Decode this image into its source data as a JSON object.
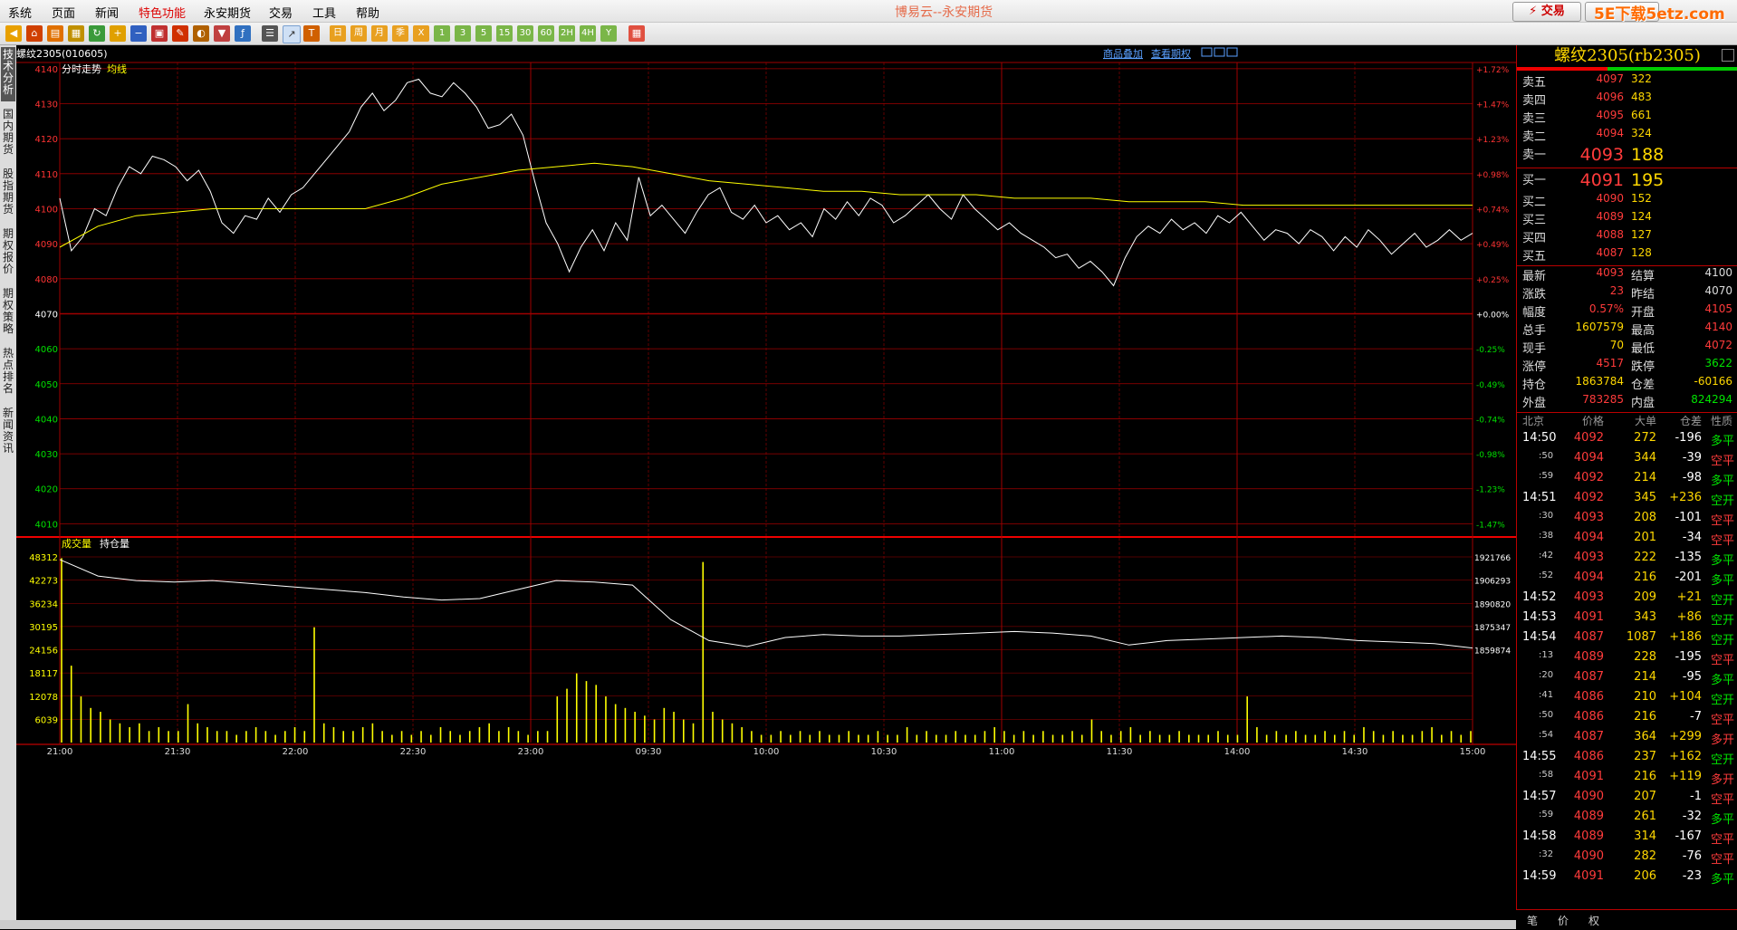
{
  "app": {
    "title": "博易云--永安期货",
    "watermark": "5E下载5etz.com",
    "trade_label": "⚡ 交易"
  },
  "menu": [
    "系统",
    "页面",
    "新闻",
    "特色功能",
    "永安期货",
    "交易",
    "工具",
    "帮助"
  ],
  "menu_active": "特色功能",
  "toolbar": {
    "icons": [
      "back-arrow-icon",
      "home-icon",
      "book-icon",
      "chart-icon",
      "refresh-icon",
      "zoom-in-icon",
      "zoom-out-icon",
      "layers-icon",
      "pen-icon",
      "palette-icon",
      "filter-icon",
      "indicator-icon",
      "table-icon",
      "trend-icon",
      "tick-icon"
    ],
    "periods": [
      "日",
      "周",
      "月",
      "季",
      "X",
      "1",
      "3",
      "5",
      "15",
      "30",
      "60",
      "2H",
      "4H",
      "Y"
    ],
    "calc_icon": "calculator-icon"
  },
  "left_tabs": [
    {
      "label": "技术分析",
      "selected": true
    },
    {
      "label": "国内期货",
      "selected": false
    },
    {
      "label": "股指期货",
      "selected": false
    },
    {
      "label": "期权报价",
      "selected": false
    },
    {
      "label": "期权策略",
      "selected": false
    },
    {
      "label": "热点排名",
      "selected": false
    },
    {
      "label": "新闻资讯",
      "selected": false
    }
  ],
  "chart": {
    "header": "螺纹2305(010605)",
    "links": [
      "商品叠加",
      "查看期权"
    ],
    "price_labels": {
      "a": "分时走势",
      "b": "均线"
    },
    "vol_labels": {
      "a": "成交量",
      "b": "持仓量"
    },
    "colors": {
      "grid": "#a00000",
      "price": "#ffffff",
      "avg": "#ffff00",
      "up": "#ff3333",
      "down": "#00e000",
      "neutral": "#ffffff",
      "axis_text_vol": "#ffff00"
    }
  },
  "chart_data": {
    "type": "line",
    "title": "分时走势",
    "reference_price": 4070,
    "price_axis": {
      "ticks": [
        4140,
        4130,
        4120,
        4110,
        4100,
        4090,
        4080,
        4070,
        4060,
        4050,
        4040,
        4030,
        4020,
        4010
      ],
      "range": [
        4007,
        4141
      ]
    },
    "pct_axis": {
      "ticks": [
        "+1.72%",
        "+1.47%",
        "+1.23%",
        "+0.98%",
        "+0.74%",
        "+0.49%",
        "+0.25%",
        "+0.00%",
        "-0.25%",
        "-0.49%",
        "-0.74%",
        "-0.98%",
        "-1.23%",
        "-1.47%"
      ]
    },
    "time_ticks": [
      "21:00",
      "21:30",
      "22:00",
      "22:30",
      "23:00",
      "09:30",
      "10:00",
      "10:30",
      "11:00",
      "11:30",
      "14:00",
      "14:30",
      "15:00"
    ],
    "series": [
      {
        "name": "分时走势",
        "x_range": [
          0,
          12
        ],
        "values": [
          4103,
          4088,
          4092,
          4100,
          4098,
          4106,
          4112,
          4110,
          4115,
          4114,
          4112,
          4108,
          4111,
          4105,
          4096,
          4093,
          4098,
          4097,
          4103,
          4099,
          4104,
          4106,
          4110,
          4114,
          4118,
          4122,
          4129,
          4133,
          4128,
          4131,
          4136,
          4137,
          4133,
          4132,
          4136,
          4133,
          4129,
          4123,
          4124,
          4127,
          4121,
          4108,
          4096,
          4090,
          4082,
          4089,
          4094,
          4088,
          4096,
          4091,
          4109,
          4098,
          4101,
          4097,
          4093,
          4099,
          4104,
          4106,
          4099,
          4097,
          4101,
          4096,
          4098,
          4094,
          4096,
          4092,
          4100,
          4097,
          4102,
          4098,
          4103,
          4101,
          4096,
          4098,
          4101,
          4104,
          4100,
          4097,
          4104,
          4100,
          4097,
          4094,
          4096,
          4093,
          4091,
          4089,
          4086,
          4087,
          4083,
          4085,
          4082,
          4078,
          4086,
          4092,
          4095,
          4093,
          4097,
          4094,
          4096,
          4093,
          4098,
          4096,
          4099,
          4095,
          4091,
          4094,
          4093,
          4090,
          4094,
          4092,
          4088,
          4092,
          4089,
          4094,
          4091,
          4087,
          4090,
          4093,
          4089,
          4091,
          4094,
          4091,
          4093
        ]
      },
      {
        "name": "均线",
        "x_range": [
          0,
          12
        ],
        "values": [
          4089,
          4095,
          4098,
          4099,
          4100,
          4100,
          4100,
          4100,
          4100,
          4103,
          4107,
          4109,
          4111,
          4112,
          4113,
          4112,
          4110,
          4108,
          4107,
          4106,
          4105,
          4105,
          4104,
          4104,
          4104,
          4103,
          4103,
          4103,
          4102,
          4102,
          4102,
          4101,
          4101,
          4101,
          4101,
          4101,
          4101,
          4101
        ]
      }
    ],
    "volume_axis": {
      "ticks": [
        48312,
        42273,
        36234,
        30195,
        24156,
        18117,
        12078,
        6039
      ]
    },
    "oi_axis": {
      "ticks": [
        1921766,
        1906293,
        1890820,
        1875347,
        1859874
      ]
    },
    "volume_spikes": [
      {
        "x": 1.8,
        "value": 30000
      },
      {
        "x": 3.9,
        "value": 47000
      },
      {
        "x": 3.5,
        "value": 18000
      },
      {
        "x": 8.4,
        "value": 12000
      }
    ],
    "volume_sample": [
      48000,
      20000,
      12000,
      9000,
      8000,
      6000,
      5000,
      4000,
      5000,
      3000,
      4000,
      3000,
      3000,
      10000,
      5000,
      4000,
      3000,
      3000,
      2000,
      3000,
      4000,
      3000,
      2000,
      3000,
      4000,
      3000,
      30000,
      5000,
      4000,
      3000,
      3000,
      4000,
      5000,
      3000,
      2000,
      3000,
      2000,
      3000,
      2000,
      4000,
      3000,
      2000,
      3000,
      4000,
      5000,
      3000,
      4000,
      3000,
      2000,
      3000,
      3000,
      12000,
      14000,
      18000,
      16000,
      15000,
      12000,
      10000,
      9000,
      8000,
      7000,
      6000,
      9000,
      8000,
      6000,
      5000,
      47000,
      8000,
      6000,
      5000,
      4000,
      3000,
      2000,
      2000,
      3000,
      2000,
      3000,
      2000,
      3000,
      2000,
      2000,
      3000,
      2000,
      2000,
      3000,
      2000,
      2000,
      4000,
      2000,
      3000,
      2000,
      2000,
      3000,
      2000,
      2000,
      3000,
      4000,
      3000,
      2000,
      3000,
      2000,
      3000,
      2000,
      2000,
      3000,
      2000,
      6000,
      3000,
      2000,
      3000,
      4000,
      2000,
      3000,
      2000,
      2000,
      3000,
      2000,
      2000,
      2000,
      3000,
      2000,
      2000,
      12000,
      4000,
      2000,
      3000,
      2000,
      3000,
      2000,
      2000,
      3000,
      2000,
      3000,
      2000,
      4000,
      3000,
      2000,
      3000,
      2000,
      2000,
      3000,
      4000,
      2000,
      3000,
      2000,
      3000
    ],
    "open_interest_values": [
      1920000,
      1909000,
      1906000,
      1905000,
      1906000,
      1904000,
      1902000,
      1900000,
      1898000,
      1895000,
      1893000,
      1894000,
      1900000,
      1906000,
      1905000,
      1903000,
      1880000,
      1866000,
      1862000,
      1868000,
      1870000,
      1869000,
      1869000,
      1870000,
      1871000,
      1872000,
      1871000,
      1869000,
      1863000,
      1866000,
      1867000,
      1868000,
      1869000,
      1868000,
      1866000,
      1865000,
      1864000,
      1861000
    ]
  },
  "quote": {
    "title": "螺纹2305(rb2305)",
    "asks": [
      {
        "label": "卖五",
        "price": "4097",
        "vol": "322"
      },
      {
        "label": "卖四",
        "price": "4096",
        "vol": "483"
      },
      {
        "label": "卖三",
        "price": "4095",
        "vol": "661"
      },
      {
        "label": "卖二",
        "price": "4094",
        "vol": "324"
      },
      {
        "label": "卖一",
        "price": "4093",
        "vol": "188"
      }
    ],
    "bids": [
      {
        "label": "买一",
        "price": "4091",
        "vol": "195"
      },
      {
        "label": "买二",
        "price": "4090",
        "vol": "152"
      },
      {
        "label": "买三",
        "price": "4089",
        "vol": "124"
      },
      {
        "label": "买四",
        "price": "4088",
        "vol": "127"
      },
      {
        "label": "买五",
        "price": "4087",
        "vol": "128"
      }
    ],
    "stats": [
      [
        "最新",
        "4093",
        "结算",
        "4100"
      ],
      [
        "涨跌",
        "23",
        "昨结",
        "4070"
      ],
      [
        "幅度",
        "0.57%",
        "开盘",
        "4105"
      ],
      [
        "总手",
        "1607579",
        "最高",
        "4140"
      ],
      [
        "现手",
        "70",
        "最低",
        "4072"
      ],
      [
        "涨停",
        "4517",
        "跌停",
        "3622"
      ],
      [
        "持仓",
        "1863784",
        "仓差",
        "-60166"
      ],
      [
        "外盘",
        "783285",
        "内盘",
        "824294"
      ]
    ],
    "trades_header": [
      "北京",
      "价格",
      "大单",
      "仓差",
      "性质"
    ],
    "trades": [
      {
        "time": "14:50",
        "price": "4092",
        "vol": "272",
        "oi": "-196",
        "nature": "多平"
      },
      {
        "time": ":50",
        "price": "4094",
        "vol": "344",
        "oi": "-39",
        "nature": "空平"
      },
      {
        "time": ":59",
        "price": "4092",
        "vol": "214",
        "oi": "-98",
        "nature": "多平"
      },
      {
        "time": "14:51",
        "price": "4092",
        "vol": "345",
        "oi": "+236",
        "nature": "空开"
      },
      {
        "time": ":30",
        "price": "4093",
        "vol": "208",
        "oi": "-101",
        "nature": "空平"
      },
      {
        "time": ":38",
        "price": "4094",
        "vol": "201",
        "oi": "-34",
        "nature": "空平"
      },
      {
        "time": ":42",
        "price": "4093",
        "vol": "222",
        "oi": "-135",
        "nature": "多平"
      },
      {
        "time": ":52",
        "price": "4094",
        "vol": "216",
        "oi": "-201",
        "nature": "多平"
      },
      {
        "time": "14:52",
        "price": "4093",
        "vol": "209",
        "oi": "+21",
        "nature": "空开"
      },
      {
        "time": "14:53",
        "price": "4091",
        "vol": "343",
        "oi": "+86",
        "nature": "空开"
      },
      {
        "time": "14:54",
        "price": "4087",
        "vol": "1087",
        "oi": "+186",
        "nature": "空开"
      },
      {
        "time": ":13",
        "price": "4089",
        "vol": "228",
        "oi": "-195",
        "nature": "空平"
      },
      {
        "time": ":20",
        "price": "4087",
        "vol": "214",
        "oi": "-95",
        "nature": "多平"
      },
      {
        "time": ":41",
        "price": "4086",
        "vol": "210",
        "oi": "+104",
        "nature": "空开"
      },
      {
        "time": ":50",
        "price": "4086",
        "vol": "216",
        "oi": "-7",
        "nature": "空平"
      },
      {
        "time": ":54",
        "price": "4087",
        "vol": "364",
        "oi": "+299",
        "nature": "多开"
      },
      {
        "time": "14:55",
        "price": "4086",
        "vol": "237",
        "oi": "+162",
        "nature": "空开"
      },
      {
        "time": ":58",
        "price": "4091",
        "vol": "216",
        "oi": "+119",
        "nature": "多开"
      },
      {
        "time": "14:57",
        "price": "4090",
        "vol": "207",
        "oi": "-1",
        "nature": "空平"
      },
      {
        "time": ":59",
        "price": "4089",
        "vol": "261",
        "oi": "-32",
        "nature": "多平"
      },
      {
        "time": "14:58",
        "price": "4089",
        "vol": "314",
        "oi": "-167",
        "nature": "空平"
      },
      {
        "time": ":32",
        "price": "4090",
        "vol": "282",
        "oi": "-76",
        "nature": "空平"
      },
      {
        "time": "14:59",
        "price": "4091",
        "vol": "206",
        "oi": "-23",
        "nature": "多平"
      }
    ],
    "bottom_tabs": [
      "笔",
      "价",
      "权"
    ]
  }
}
